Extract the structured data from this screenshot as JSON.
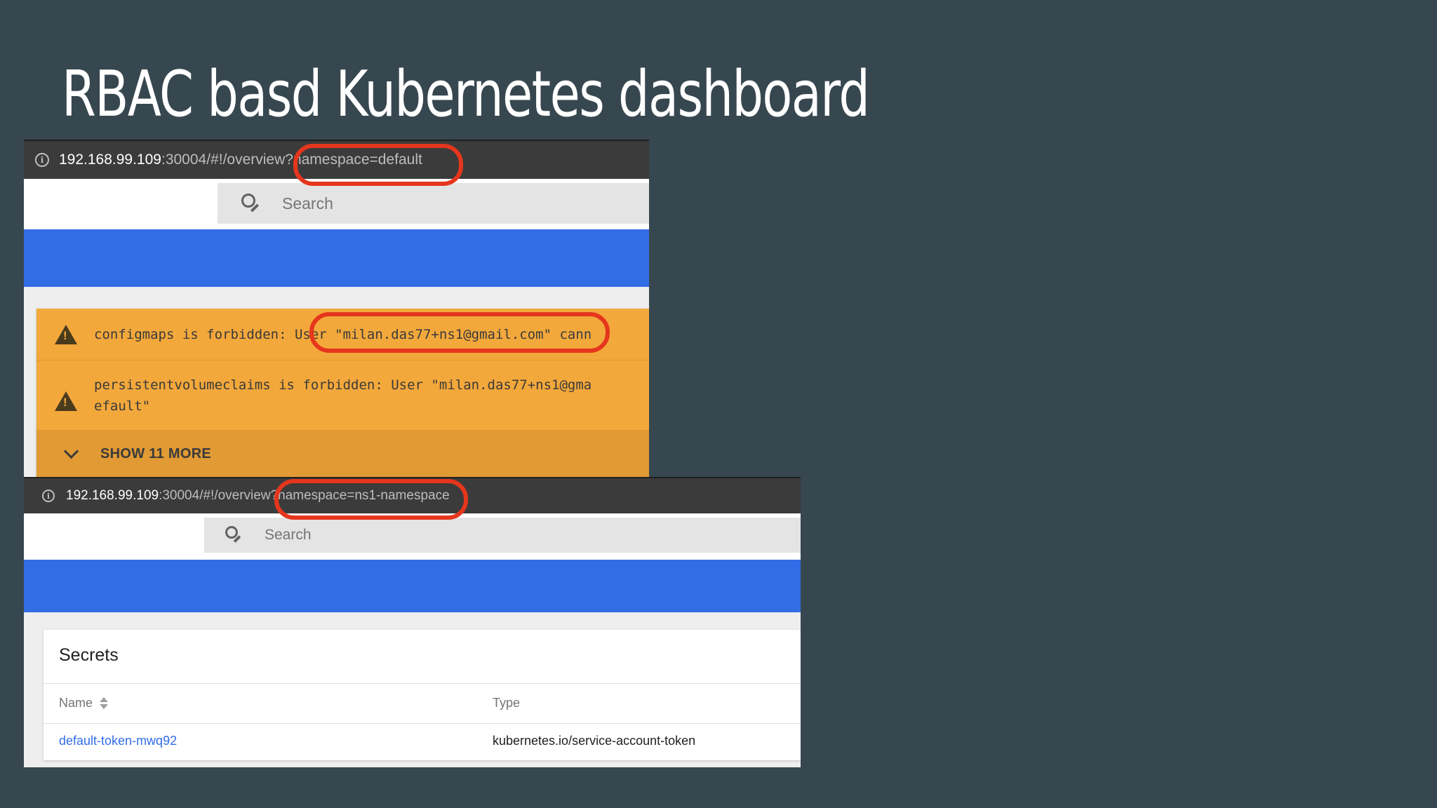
{
  "slide": {
    "title": "RBAC basd Kubernetes dashboard"
  },
  "colors": {
    "background": "#37474f",
    "kubernetes_blue": "#326de6",
    "warning": "#f3a83b",
    "highlight_ring": "#e5361d"
  },
  "screenshot_default": {
    "url": {
      "info_icon": "i",
      "host": "192.168.99.109",
      "path": ":30004/#!/overview?",
      "query": "namespace=default"
    },
    "search_placeholder": "Search",
    "warnings": [
      {
        "icon": "warning-icon",
        "text": "configmaps is forbidden: User \"milan.das77+ns1@gmail.com\" cann"
      },
      {
        "icon": "warning-icon",
        "text": "persistentvolumeclaims is forbidden: User \"milan.das77+ns1@gma\nefault\""
      }
    ],
    "show_more_label": "SHOW 11 MORE"
  },
  "screenshot_ns1": {
    "url": {
      "info_icon": "i",
      "host": "192.168.99.109",
      "path": ":30004/#!/overview?",
      "query": "namespace=ns1-namespace"
    },
    "search_placeholder": "Search",
    "secrets_card": {
      "title": "Secrets",
      "columns": [
        "Name",
        "Type"
      ],
      "rows": [
        {
          "name": "default-token-mwq92",
          "type": "kubernetes.io/service-account-token"
        }
      ]
    }
  }
}
